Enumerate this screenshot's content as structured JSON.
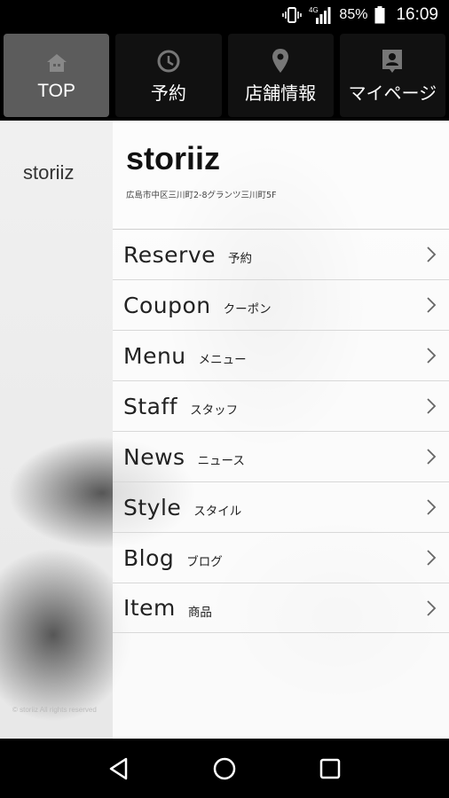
{
  "status_bar": {
    "network": "4G",
    "battery_percent": "85%",
    "time": "16:09",
    "icons": [
      "vibrate-icon",
      "signal-icon",
      "battery-icon"
    ]
  },
  "tabs": [
    {
      "label": "TOP",
      "icon": "home-icon",
      "active": true
    },
    {
      "label": "予約",
      "icon": "clock-icon",
      "active": false
    },
    {
      "label": "店舗情報",
      "icon": "location-pin-icon",
      "active": false
    },
    {
      "label": "マイページ",
      "icon": "person-card-icon",
      "active": false
    }
  ],
  "sidebar": {
    "brand": "storiiz",
    "copyright": "© storiiz All rights reserved"
  },
  "shop": {
    "name": "storiiz",
    "address": "広島市中区三川町2-8グランツ三川町5F"
  },
  "menu": [
    {
      "en": "Reserve",
      "ja": "予約"
    },
    {
      "en": "Coupon",
      "ja": "クーポン"
    },
    {
      "en": "Menu",
      "ja": "メニュー"
    },
    {
      "en": "Staff",
      "ja": "スタッフ"
    },
    {
      "en": "News",
      "ja": "ニュース"
    },
    {
      "en": "Style",
      "ja": "スタイル"
    },
    {
      "en": "Blog",
      "ja": "ブログ"
    },
    {
      "en": "Item",
      "ja": "商品"
    }
  ],
  "nav_bar": {
    "icons": [
      "back-icon",
      "home-circle-icon",
      "recent-apps-icon"
    ]
  },
  "colors": {
    "active_tab": "#5c5c5c",
    "tab_bg": "#111111",
    "bar_bg": "#000000"
  }
}
